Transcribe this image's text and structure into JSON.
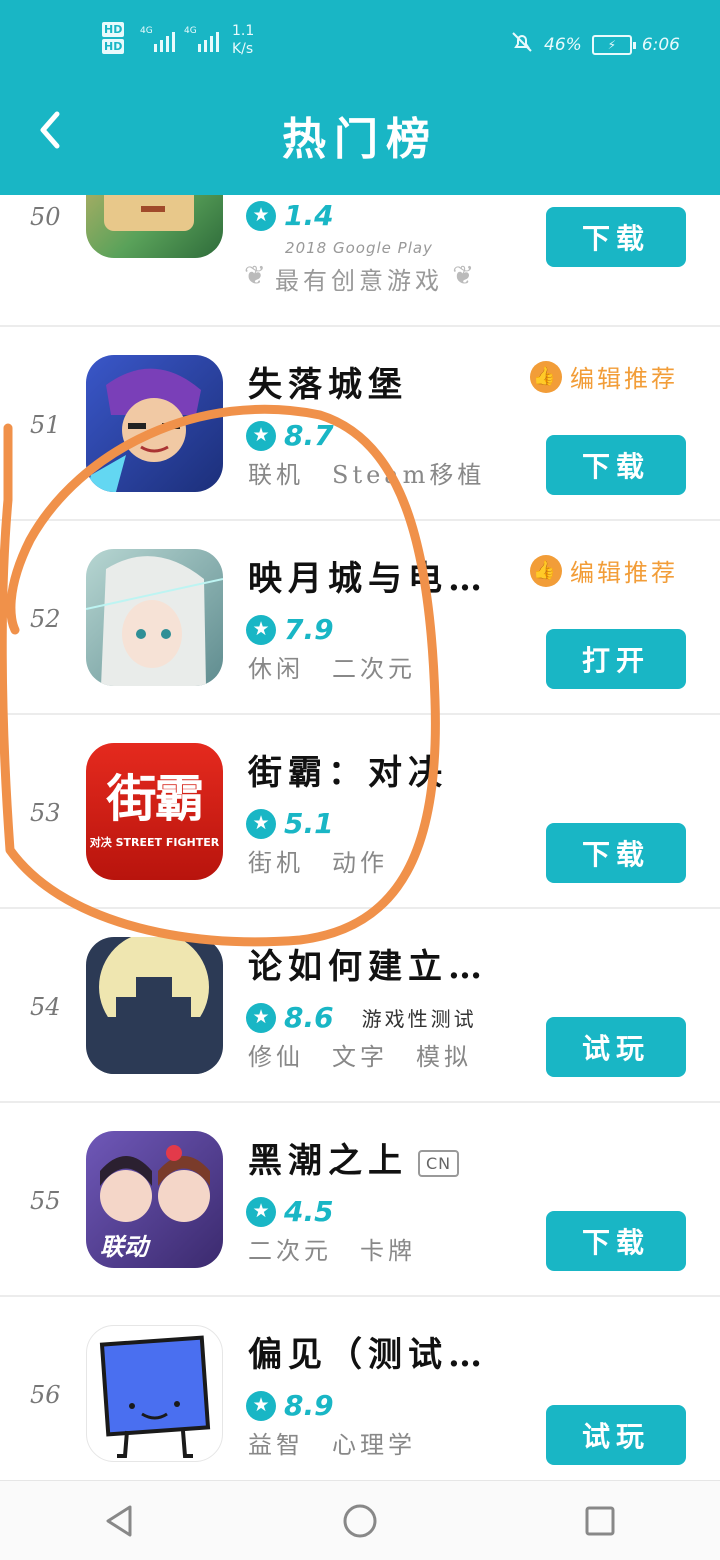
{
  "status_bar": {
    "hd1": "HD",
    "hd2": "HD",
    "net1": "4G",
    "net2": "4G",
    "speed_value": "1.1",
    "speed_unit": "K/s",
    "battery_percent": "46%",
    "time": "6:06"
  },
  "header": {
    "title": "热门榜",
    "back_icon": "chevron-left-icon"
  },
  "rows": [
    {
      "rank": "50",
      "rating": "1.4",
      "award_line1": "2018 Google Play",
      "award_line2": "最有创意游戏",
      "button": "下载"
    },
    {
      "rank": "51",
      "name": "失落城堡",
      "editor": "编辑推荐",
      "rating": "8.7",
      "tags": [
        "联机",
        "Steam移植"
      ],
      "button": "下载"
    },
    {
      "rank": "52",
      "name": "映月城与电…",
      "editor": "编辑推荐",
      "rating": "7.9",
      "tags": [
        "休闲",
        "二次元"
      ],
      "button": "打开"
    },
    {
      "rank": "53",
      "name": "街霸：对决",
      "rating": "5.1",
      "tags": [
        "街机",
        "动作"
      ],
      "button": "下载",
      "icon_text": "街霸",
      "icon_sub": "对决 STREET FIGHTER"
    },
    {
      "rank": "54",
      "name": "论如何建立…",
      "rating": "8.6",
      "note": "游戏性测试",
      "tags": [
        "修仙",
        "文字",
        "模拟"
      ],
      "button": "试玩"
    },
    {
      "rank": "55",
      "name": "黑潮之上",
      "badge": "CN",
      "rating": "4.5",
      "tags": [
        "二次元",
        "卡牌"
      ],
      "button": "下载",
      "icon_text": "联动"
    },
    {
      "rank": "56",
      "name": "偏见（测试…",
      "rating": "8.9",
      "tags": [
        "益智",
        "心理学"
      ],
      "button": "试玩"
    }
  ],
  "nav": {
    "back": "triangle-back-icon",
    "home": "circle-home-icon",
    "recent": "square-recent-icon"
  },
  "colors": {
    "accent": "#19b6c5",
    "editor": "#f29d38",
    "annotation": "#f0914a"
  }
}
